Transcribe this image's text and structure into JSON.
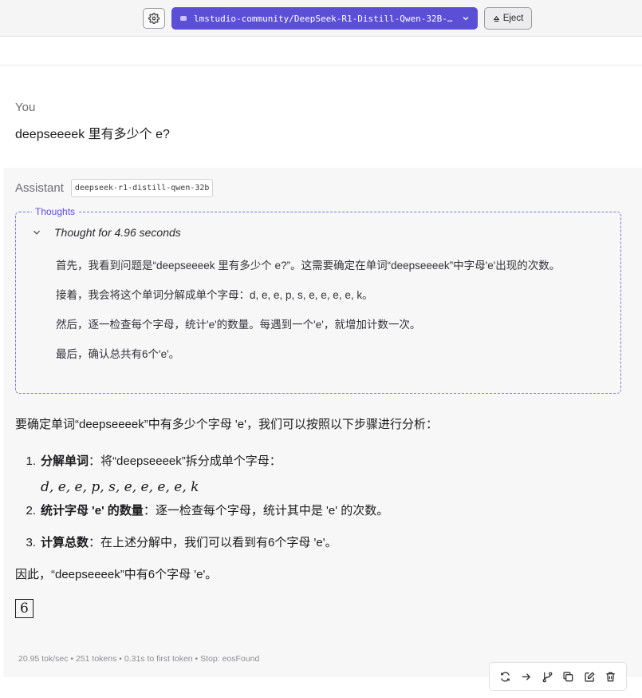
{
  "topbar": {
    "model_name": "lmstudio-community/DeepSeek-R1-Distill-Qwen-32B-…",
    "eject_label": "Eject",
    "accent_color": "#5b4fd6"
  },
  "user": {
    "role": "You",
    "message": "deepseeeek 里有多少个 e?"
  },
  "assistant": {
    "role": "Assistant",
    "model_tag": "deepseek-r1-distill-qwen-32b",
    "thoughts_label": "Thoughts",
    "thought_title": "Thought for 4.96 seconds",
    "thought_paragraphs": [
      "首先，我看到问题是“deepseeeek 里有多少个 e?”。这需要确定在单词“deepseeeek”中字母'e'出现的次数。",
      "接着，我会将这个单词分解成单个字母：d, e, e, p, s, e, e, e, e, k。",
      "然后，逐一检查每个字母，统计'e'的数量。每遇到一个'e'，就增加计数一次。",
      "最后，确认总共有6个'e'。"
    ],
    "answer_intro": "要确定单词“deepseeeek”中有多少个字母 'e'，我们可以按照以下步骤进行分析：",
    "steps": [
      {
        "num": "1.",
        "bold": "分解单词",
        "text": "：将“deepseeeek”拆分成单个字母："
      },
      {
        "num": "2.",
        "bold": "统计字母 'e' 的数量",
        "text": "：逐一检查每个字母，统计其中是 'e' 的次数。"
      },
      {
        "num": "3.",
        "bold": "计算总数",
        "text": "：在上述分解中，我们可以看到有6个字母 'e'。"
      }
    ],
    "math_letters": "d, e, e, p, s, e, e, e, e, k",
    "conclusion": "因此，“deepseeeek”中有6个字母 'e'。",
    "boxed_answer": "6",
    "stats": "20.95 tok/sec  •  251 tokens  •  0.31s to first token  •  Stop: eosFound"
  },
  "actions": [
    "regenerate-icon",
    "continue-icon",
    "branch-icon",
    "copy-icon",
    "edit-icon",
    "delete-icon"
  ]
}
